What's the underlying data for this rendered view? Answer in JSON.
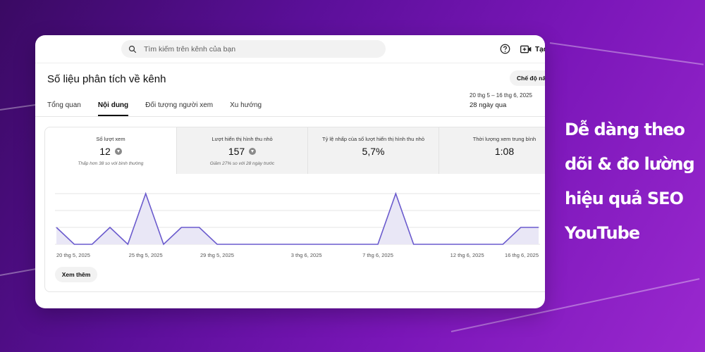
{
  "search": {
    "placeholder": "Tìm kiếm trên kênh của bạn"
  },
  "header": {
    "create_label": "Tạo",
    "help_icon": "help-circle-icon",
    "create_icon": "video-plus-icon"
  },
  "page": {
    "title": "Số liệu phân tích về kênh",
    "mode_button": "Chế độ nâng cao",
    "date_range": "20 thg 5 – 16 thg 6, 2025",
    "date_label": "28 ngày qua"
  },
  "tabs": [
    {
      "label": "Tổng quan",
      "active": false
    },
    {
      "label": "Nội dung",
      "active": true
    },
    {
      "label": "Đối tượng người xem",
      "active": false
    },
    {
      "label": "Xu hướng",
      "active": false
    }
  ],
  "metrics": [
    {
      "label": "Số lượt xem",
      "value": "12",
      "trend": "down",
      "note": "Thấp hơn 38 so với bình thường"
    },
    {
      "label": "Lượt hiển thị hình thu nhỏ",
      "value": "157",
      "trend": "down",
      "note": "Giảm 27% so với 28 ngày trước"
    },
    {
      "label": "Tỷ lệ nhấp của số lượt hiển thị hình thu nhỏ",
      "value": "5,7%",
      "trend": "",
      "note": ""
    },
    {
      "label": "Thời lượng xem trung bình",
      "value": "1:08",
      "trend": "",
      "note": ""
    }
  ],
  "chart_data": {
    "type": "area",
    "title": "",
    "x_tick_labels": [
      "20 thg 5, 2025",
      "25 thg 5, 2025",
      "29 thg 5, 2025",
      "3 thg 6, 2025",
      "7 thg 6, 2025",
      "12 thg 6, 2025",
      "16 thg 6, 2025"
    ],
    "x_tick_indices": [
      0,
      5,
      9,
      14,
      18,
      23,
      27
    ],
    "series": [
      {
        "values": [
          1,
          0,
          0,
          1,
          0,
          3,
          0,
          1,
          1,
          0,
          0,
          0,
          0,
          0,
          0,
          0,
          0,
          0,
          0,
          3,
          0,
          0,
          0,
          0,
          0,
          0,
          1,
          1
        ]
      }
    ],
    "ylim": [
      0,
      3
    ],
    "grid": true,
    "colors": {
      "line": "#6a5acd",
      "fill": "#e9e7f6"
    }
  },
  "see_more_label": "Xem thêm",
  "slogan": [
    "Dễ dàng theo",
    "dõi & đo lường",
    "hiệu quả SEO",
    "YouTube"
  ]
}
